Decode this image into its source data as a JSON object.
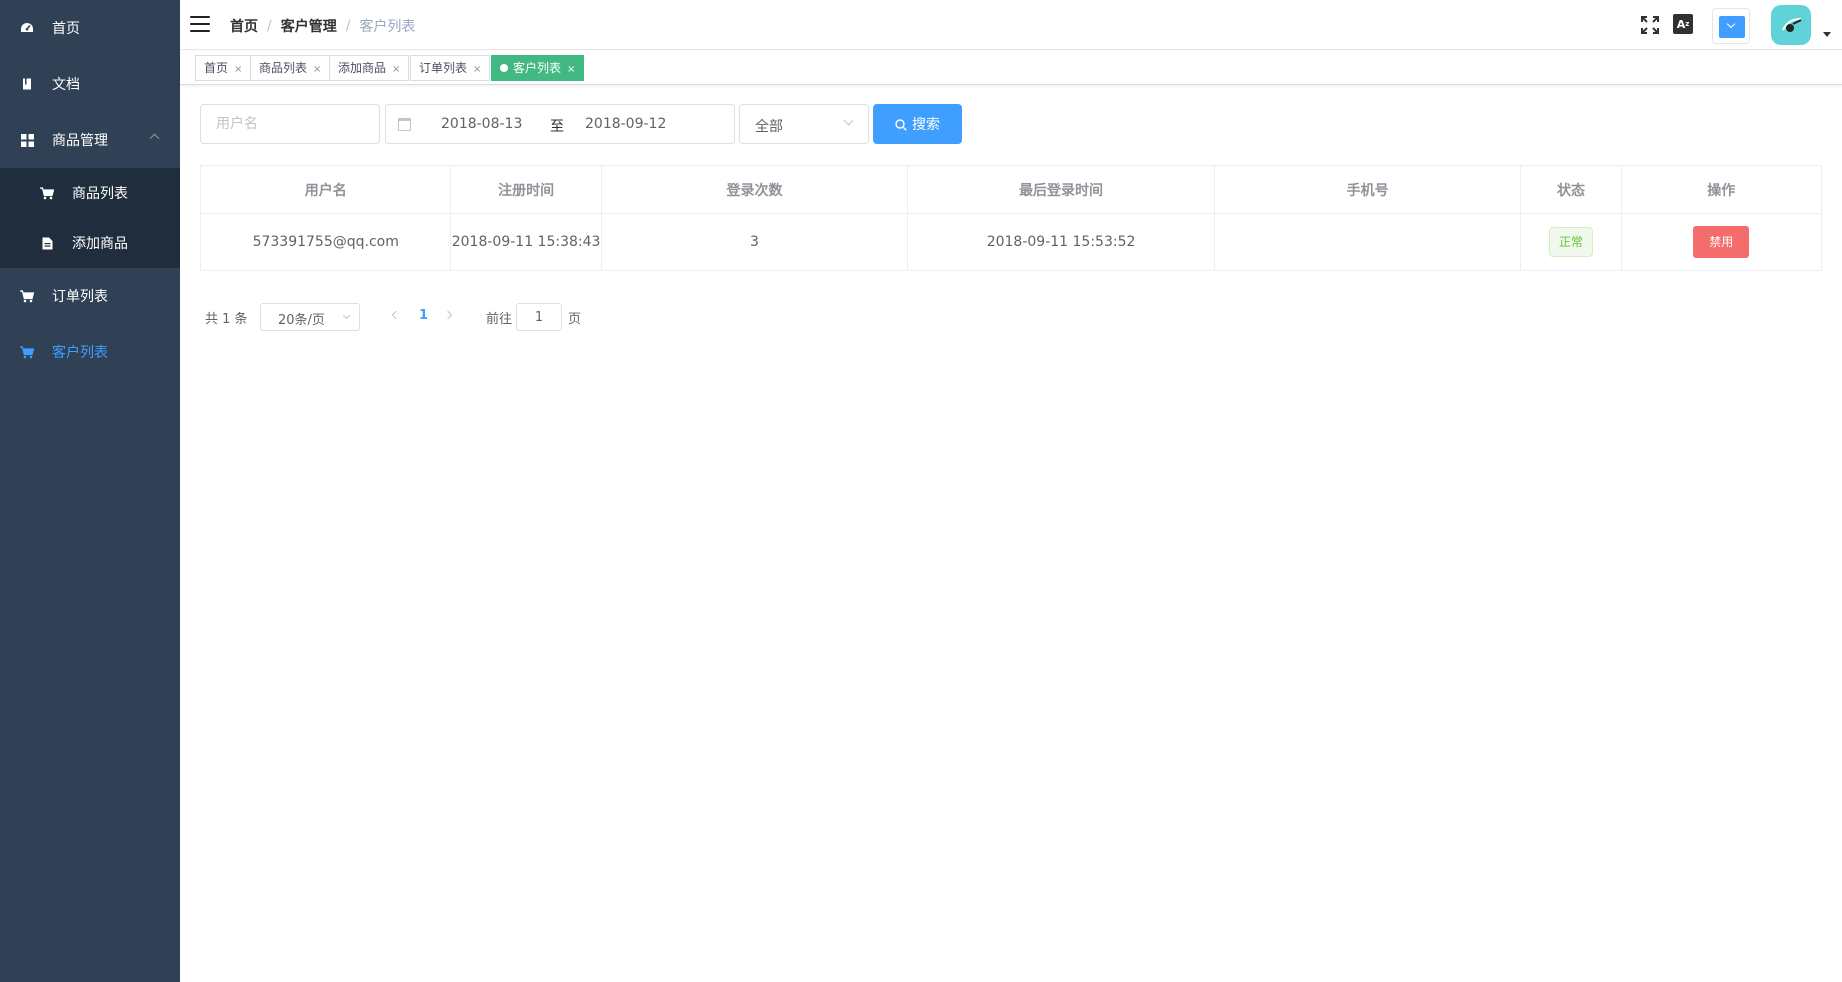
{
  "sidebar": {
    "items": [
      {
        "label": "首页",
        "icon": "dashboard-icon"
      },
      {
        "label": "文档",
        "icon": "document-icon"
      },
      {
        "label": "商品管理",
        "icon": "grid-icon",
        "expanded": true,
        "children": [
          {
            "label": "商品列表",
            "icon": "cart-icon"
          },
          {
            "label": "添加商品",
            "icon": "file-icon"
          }
        ]
      },
      {
        "label": "订单列表",
        "icon": "cart-icon"
      },
      {
        "label": "客户列表",
        "icon": "cart-icon",
        "active": true
      }
    ],
    "colors": {
      "bg": "#304156",
      "submenu_bg": "#1f2d3d",
      "active_text": "#409eff"
    }
  },
  "navbar": {
    "breadcrumb": [
      "首页",
      "客户管理",
      "客户列表"
    ],
    "separator": "/",
    "lang_label": "A",
    "icons": [
      "hamburger-icon",
      "fullscreen-icon",
      "language-icon",
      "theme-picker-icon",
      "avatar",
      "caret-down-icon"
    ]
  },
  "tags": [
    {
      "label": "首页",
      "close": "×"
    },
    {
      "label": "商品列表",
      "close": "×"
    },
    {
      "label": "添加商品",
      "close": "×"
    },
    {
      "label": "订单列表",
      "close": "×"
    },
    {
      "label": "客户列表",
      "close": "×",
      "active": true
    }
  ],
  "filters": {
    "username_placeholder": "用户名",
    "date_start": "2018-08-13",
    "date_separator": "至",
    "date_end": "2018-09-12",
    "status_value": "全部",
    "search_label": "搜索"
  },
  "table": {
    "headers": [
      "用户名",
      "注册时间",
      "登录次数",
      "最后登录时间",
      "手机号",
      "状态",
      "操作"
    ],
    "rows": [
      {
        "username": "573391755@qq.com",
        "registered": "2018-09-11 15:38:43",
        "login_count": "3",
        "last_login": "2018-09-11 15:53:52",
        "phone": "",
        "status": "正常",
        "action": "禁用"
      }
    ]
  },
  "pagination": {
    "total": "共 1 条",
    "page_size": "20条/页",
    "current_page": "1",
    "goto_label": "前往",
    "goto_value": "1",
    "page_suffix": "页"
  },
  "colors": {
    "primary": "#409eff",
    "tag_active": "#42b983",
    "success": "#67c23a",
    "danger": "#f56c6c"
  }
}
